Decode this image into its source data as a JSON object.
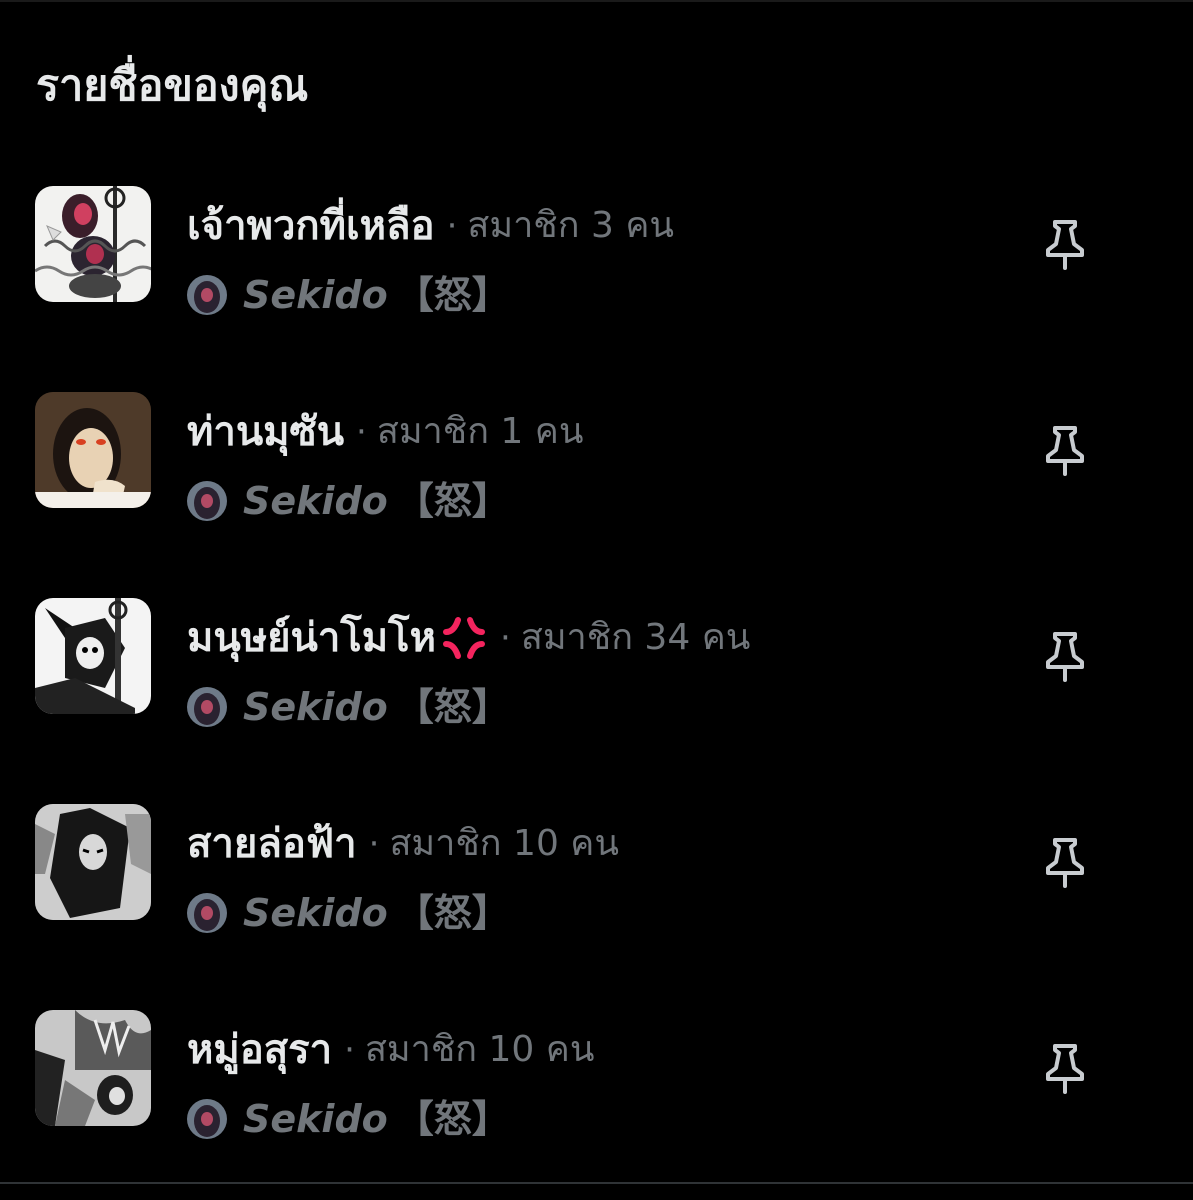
{
  "section": {
    "title": "รายชื่อของคุณ"
  },
  "separator": "·",
  "lists": [
    {
      "name": "เจ้าพวกที่เหลือ",
      "member_count": "สมาชิก 3 คน",
      "owner_name": "Sekido",
      "owner_suffix": "【怒】",
      "has_emoji": false
    },
    {
      "name": "ท่านมุซัน",
      "member_count": "สมาชิก 1 คน",
      "owner_name": "Sekido",
      "owner_suffix": "【怒】",
      "has_emoji": false
    },
    {
      "name": "มนุษย์น่าโมโห",
      "member_count": "สมาชิก 34 คน",
      "owner_name": "Sekido",
      "owner_suffix": "【怒】",
      "has_emoji": true,
      "emoji": "anger-symbol-icon"
    },
    {
      "name": "สายล่อฟ้า",
      "member_count": "สมาชิก 10 คน",
      "owner_name": "Sekido",
      "owner_suffix": "【怒】",
      "has_emoji": false
    },
    {
      "name": "หมู่อสุรา",
      "member_count": "สมาชิก 10 คน",
      "owner_name": "Sekido",
      "owner_suffix": "【怒】",
      "has_emoji": false
    }
  ],
  "icons": {
    "pin": "pin-icon",
    "anger": "anger-symbol-icon"
  },
  "colors": {
    "background": "#000000",
    "primary_text": "#e7e9ea",
    "secondary_text": "#71767b",
    "anger_red": "#f4245e"
  }
}
